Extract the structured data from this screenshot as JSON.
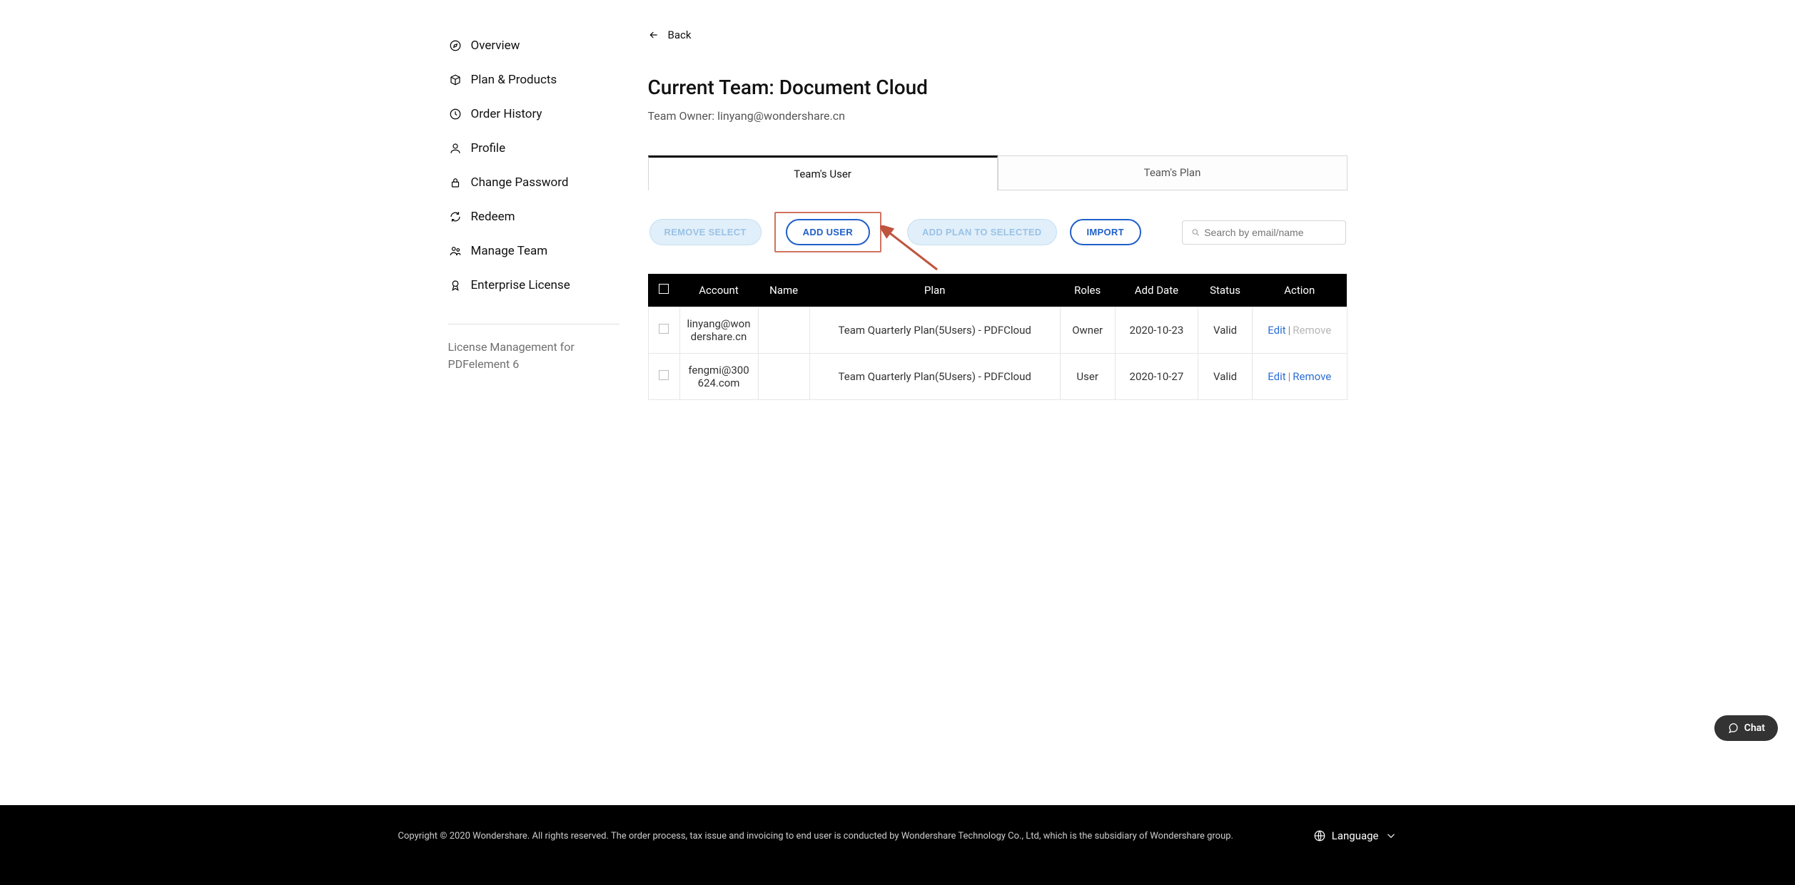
{
  "sidebar": {
    "items": [
      {
        "label": "Overview"
      },
      {
        "label": "Plan & Products"
      },
      {
        "label": "Order History"
      },
      {
        "label": "Profile"
      },
      {
        "label": "Change Password"
      },
      {
        "label": "Redeem"
      },
      {
        "label": "Manage Team"
      },
      {
        "label": "Enterprise License"
      }
    ],
    "note": "License Management for PDFelement 6"
  },
  "main": {
    "back": "Back",
    "title": "Current Team: Document Cloud",
    "owner": "Team Owner: linyang@wondershare.cn",
    "tabs": [
      {
        "label": "Team's User"
      },
      {
        "label": "Team's Plan"
      }
    ],
    "buttons": {
      "remove": "REMOVE SELECT",
      "add_user": "ADD USER",
      "add_plan": "ADD PLAN TO SELECTED",
      "import": "IMPORT"
    },
    "search_placeholder": "Search by email/name",
    "table": {
      "headers": [
        "Account",
        "Name",
        "Plan",
        "Roles",
        "Add Date",
        "Status",
        "Action"
      ],
      "rows": [
        {
          "account": "linyang@wondershare.cn",
          "name": "",
          "plan": "Team Quarterly Plan(5Users) - PDFCloud",
          "roles": "Owner",
          "date": "2020-10-23",
          "status": "Valid",
          "remove_enabled": false
        },
        {
          "account": "fengmi@300624.com",
          "name": "",
          "plan": "Team Quarterly Plan(5Users) - PDFCloud",
          "roles": "User",
          "date": "2020-10-27",
          "status": "Valid",
          "remove_enabled": true
        }
      ],
      "action_edit": "Edit",
      "action_remove": "Remove"
    }
  },
  "footer": {
    "copyright": "Copyright © 2020 Wondershare. All rights reserved. The order process, tax issue and invoicing to end user is conducted by Wondershare Technology Co., Ltd, which is the subsidiary of Wondershare group.",
    "language": "Language"
  },
  "chat": "Chat"
}
